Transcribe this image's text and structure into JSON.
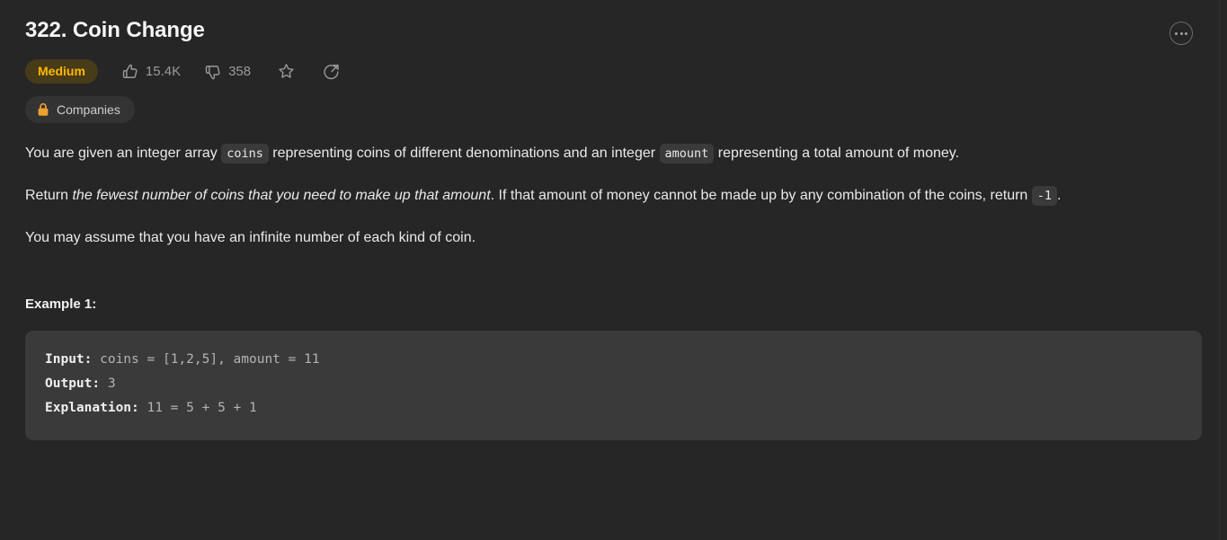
{
  "problem": {
    "title": "322. Coin Change",
    "difficulty": "Medium",
    "likes": "15.4K",
    "dislikes": "358",
    "companies_label": "Companies"
  },
  "description": {
    "p1_part1": "You are given an integer array ",
    "p1_code1": "coins",
    "p1_part2": " representing coins of different denominations and an integer ",
    "p1_code2": "amount",
    "p1_part3": " representing a total amount of money.",
    "p2_part1": "Return ",
    "p2_em": "the fewest number of coins that you need to make up that amount",
    "p2_part2": ". If that amount of money cannot be made up by any combination of the coins, return ",
    "p2_code": "-1",
    "p2_part3": ".",
    "p3": "You may assume that you have an infinite number of each kind of coin."
  },
  "examples": [
    {
      "heading": "Example 1:",
      "input_label": "Input:",
      "input_value": " coins = [1,2,5], amount = 11",
      "output_label": "Output:",
      "output_value": " 3",
      "explanation_label": "Explanation:",
      "explanation_value": " 11 = 5 + 5 + 1"
    }
  ],
  "colors": {
    "page_background": "#262626",
    "code_background": "#3a3a3a",
    "difficulty_text": "#ffb800",
    "difficulty_background": "#473b18",
    "lock_accent": "#f0a030"
  }
}
